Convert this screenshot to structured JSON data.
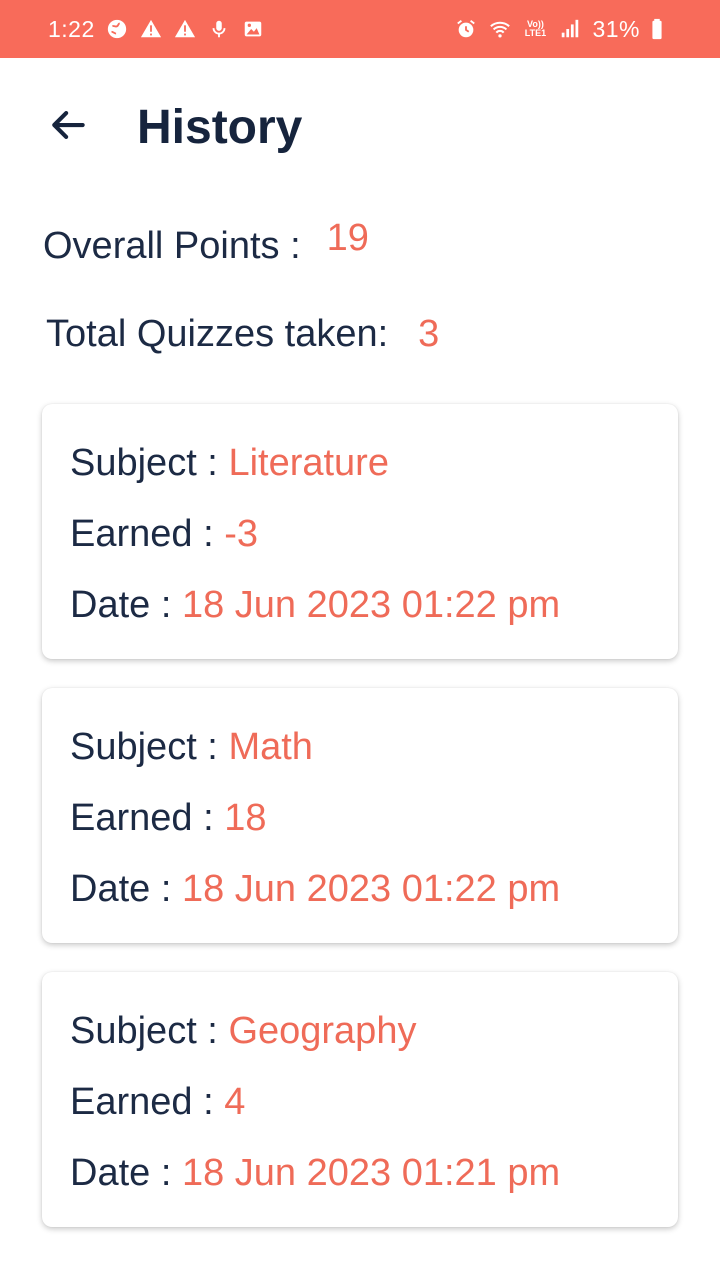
{
  "status_bar": {
    "time": "1:22",
    "battery": "31%",
    "network_badge": "Vo))\nLTE1",
    "left_icons": [
      "globe-icon",
      "warning-icon",
      "warning-icon",
      "mic-icon",
      "image-icon"
    ],
    "right_icons": [
      "alarm-icon",
      "wifi-icon",
      "volte-icon",
      "signal-icon",
      "battery-icon"
    ]
  },
  "header": {
    "title": "History",
    "back_icon": "arrow-left-icon"
  },
  "summary": {
    "points_label": "Overall Points :",
    "points_value": "19",
    "quizzes_label": "Total Quizzes taken:",
    "quizzes_value": "3"
  },
  "labels": {
    "subject": "Subject :",
    "earned": "Earned :",
    "date": "Date :"
  },
  "history": [
    {
      "subject": "Literature",
      "earned": "-3",
      "date": "18 Jun 2023 01:22 pm"
    },
    {
      "subject": "Math",
      "earned": "18",
      "date": "18 Jun 2023 01:22 pm"
    },
    {
      "subject": "Geography",
      "earned": "4",
      "date": "18 Jun 2023 01:21 pm"
    }
  ],
  "colors": {
    "status_bar": "#f86b5a",
    "accent": "#ef6b58",
    "text": "#1c2a44"
  }
}
